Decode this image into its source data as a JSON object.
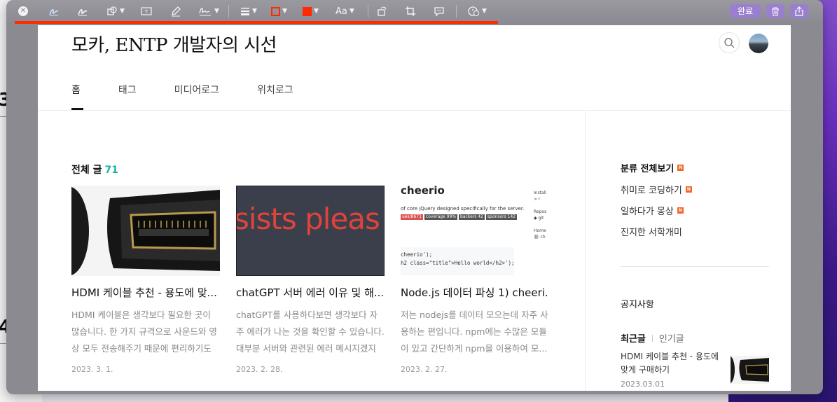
{
  "toolbar": {
    "done_label": "완료",
    "text_size_label": "Aa",
    "border_color": "#ff2a00",
    "fill_color": "#ff2a00"
  },
  "blog": {
    "title": "모카, ENTP 개발자의 시선"
  },
  "nav": {
    "items": [
      {
        "label": "홈"
      },
      {
        "label": "태그"
      },
      {
        "label": "미디어로그"
      },
      {
        "label": "위치로그"
      }
    ]
  },
  "posts": {
    "heading": "전체 글",
    "count": "71",
    "cards": [
      {
        "title": "HDMI 케이블 추천 - 용도에 맞...",
        "desc": "HDMI 케이블은 생각보다 필요한 곳이 많습니다. 한 가지 규격으로 사운드와 영상 모두 전송해주기 때문에 편리하기도 합...",
        "date": "2023. 3. 1."
      },
      {
        "title": "chatGPT 서버 에러 이유 및 해...",
        "desc": "chatGPT를 사용하다보면 생각보다 자주 에러가 나는 것을 확인할 수 있습니다. 대부분 서버와 관련된 에러 메시지겠지만...",
        "date": "2023. 2. 28.",
        "thumb_text": "sists pleas"
      },
      {
        "title": "Node.js 데이터 파싱 1) cheeri...",
        "desc": "저는 nodejs를 데이터 모으는데 자주 사용하는 편입니다. npm에는 수많은 모듈이 있고 간단하게 npm을 이용하여 모...",
        "date": "2023. 2. 27.",
        "thumb_heading": "cheerio",
        "thumb_sub": "of core jQuery designed specifically for the server.",
        "thumb_code_1": "cheerio');",
        "thumb_code_2": "h2 class=\"title\">Hello world</h2>');",
        "thumb_side": [
          "Install",
          "> r",
          "",
          "Repos",
          "◆ git",
          "",
          "Home",
          "⛓ ch"
        ],
        "thumb_badges": [
          "ues/8671",
          "coverage 99%",
          "backers 42",
          "sponsors 142"
        ]
      }
    ]
  },
  "sidebar": {
    "category_all": "분류 전체보기",
    "categories": [
      {
        "label": "취미로 코딩하기",
        "new": true
      },
      {
        "label": "일하다가 몽상",
        "new": true
      },
      {
        "label": "진지한 서학개미",
        "new": false
      }
    ],
    "new_badge": "N",
    "notice": "공지사항",
    "tab_recent": "최근글",
    "tab_popular": "인기글",
    "recent": {
      "title": "HDMI 케이블 추천 - 용도에 맞게 구매하기",
      "date": "2023.03.01"
    }
  }
}
